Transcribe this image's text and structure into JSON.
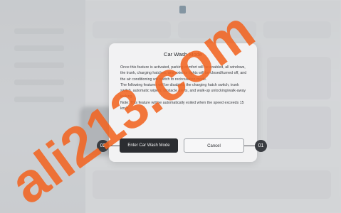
{
  "dialog": {
    "title": "Car Wash Mode",
    "paragraph1": "Once this feature is activated, parking comfort will be enabled, all windows, the trunk, charging hatches, and exterior lights will be closed/turned off, and the air conditioning will switch to recirculation mode.",
    "paragraph2": "The following features will be disabled: the charging hatch switch, trunk switch, automatic wipers, obstacle alerts, and walk-up unlocking/walk-away locking.",
    "paragraph3": "Note: This feature will be automatically exited when the speed exceeds 15 km/h.",
    "primary_button": "Enter Car Wash Mode",
    "secondary_button": "Cancel"
  },
  "callouts": {
    "left": "02",
    "right": "01"
  },
  "watermark": "ali213.com",
  "colors": {
    "watermark": "#f26522",
    "primary_button_bg": "#2b2d31",
    "dialog_bg": "#f2f2f3"
  }
}
